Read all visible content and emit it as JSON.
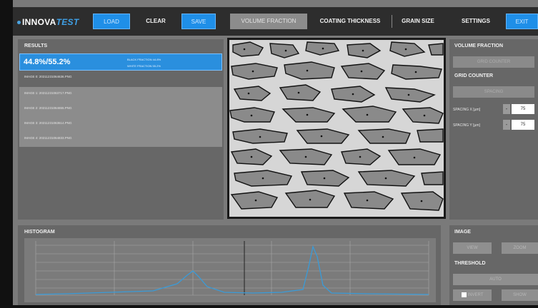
{
  "brand": {
    "prefix": "INNOVA",
    "accent": "TEST"
  },
  "toolbar": {
    "load": "LOAD",
    "clear": "CLEAR",
    "save": "SAVE",
    "volume_fraction": "VOLUME FRACTION",
    "coating_thickness": "COATING THICKNESS",
    "grain_size": "GRAIN SIZE",
    "settings": "SETTINGS",
    "exit": "EXIT"
  },
  "results": {
    "title": "RESULTS",
    "value": "44.8%/55.2%",
    "black_fraction": "BLACK FRACTION 44.8%",
    "white_fraction": "WHITE FRACTION 55.2%",
    "images": [
      "IMAGE 0: 20211231064636.PNG",
      "IMAGE 1: 20211231063717.PNG",
      "IMAGE 2: 20211231064655.PNG",
      "IMAGE 3: 20211231063614.PNG",
      "IMAGE 4: 20211231064833.PNG"
    ]
  },
  "volume_fraction_panel": {
    "title": "VOLUME FRACTION",
    "grid_counter_button": "GRID COUNTER",
    "grid_counter_title": "GRID COUNTER",
    "spacing_button": "SPACING",
    "spacing_x_label": "SPACING X [µm]",
    "spacing_x_value": "75",
    "spacing_y_label": "SPACING Y [µm]",
    "spacing_y_value": "75"
  },
  "histogram": {
    "title": "HISTOGRAM"
  },
  "image_panel": {
    "title": "IMAGE",
    "btn1": "VIEW",
    "btn2": "ZOOM",
    "threshold_title": "THRESHOLD",
    "auto": "AUTO",
    "invert": "INVERT",
    "show": "SHOW"
  },
  "colors": {
    "accent": "#1f8fe8",
    "panel": "#676767",
    "topbar": "#2d2d2d"
  }
}
